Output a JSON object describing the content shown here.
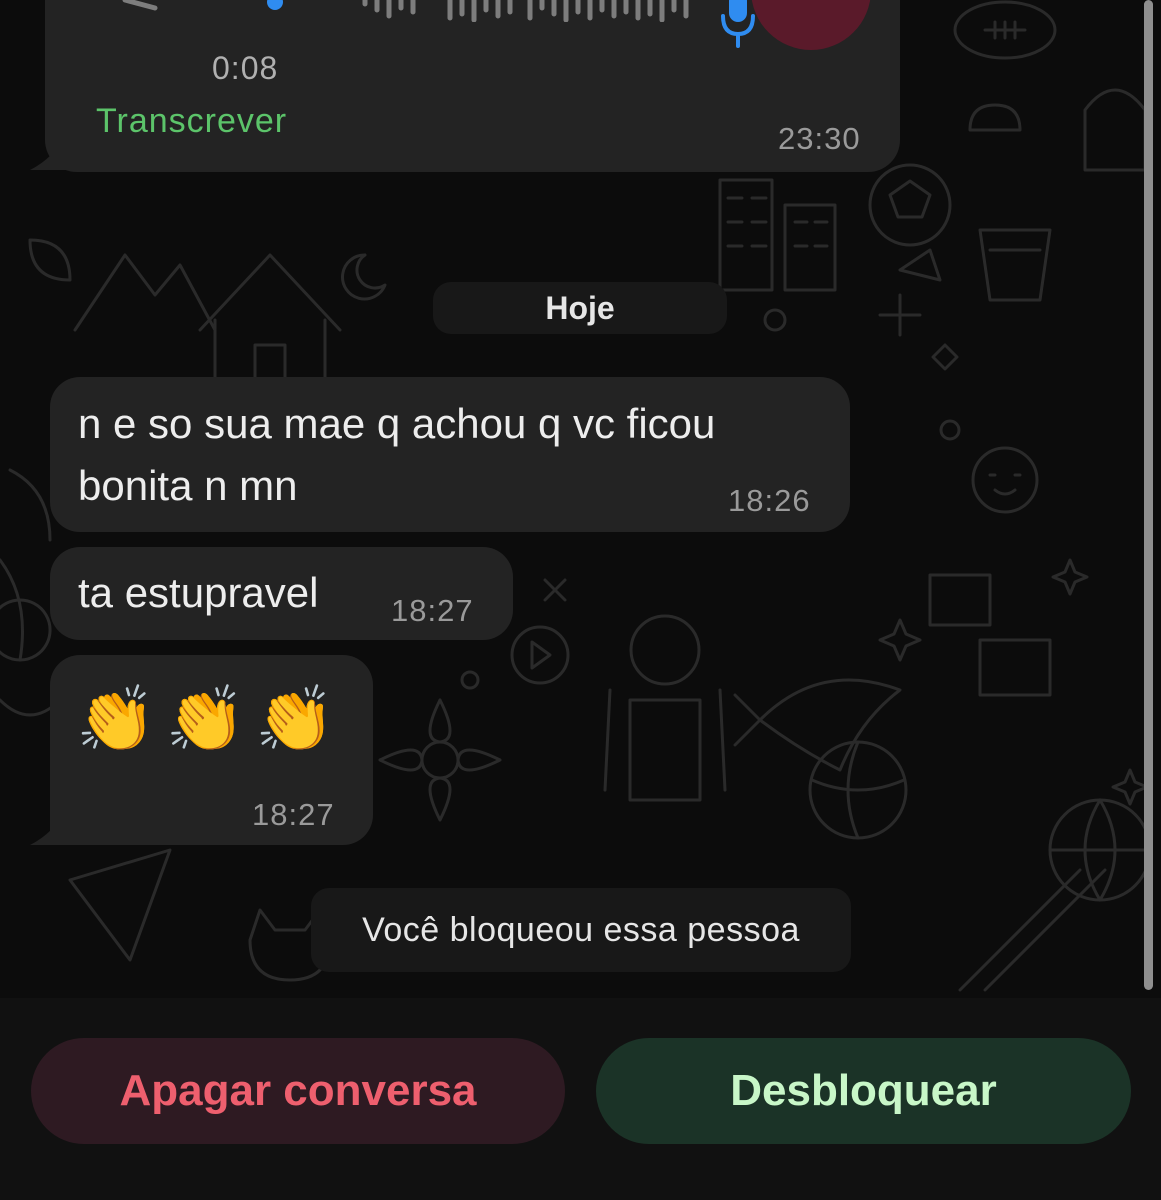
{
  "voice_message": {
    "duration": "0:08",
    "transcribe_label": "Transcrever",
    "time": "23:30"
  },
  "date_divider": "Hoje",
  "messages": [
    {
      "line1": "n e so sua mae q achou q vc ficou",
      "line2": "bonita n mn",
      "time": "18:26"
    },
    {
      "text": "ta estupravel",
      "time": "18:27"
    },
    {
      "emoji": "👏👏👏",
      "time": "18:27"
    }
  ],
  "system_notice": "Você bloqueou essa pessoa",
  "actions": {
    "delete_label": "Apagar conversa",
    "unblock_label": "Desbloquear"
  },
  "colors": {
    "transcribe": "#5cc46a",
    "delete_text": "#ee5f6e",
    "delete_bg": "#2e1a22",
    "unblock_text": "#c8f7c8",
    "unblock_bg": "#1b3327"
  }
}
